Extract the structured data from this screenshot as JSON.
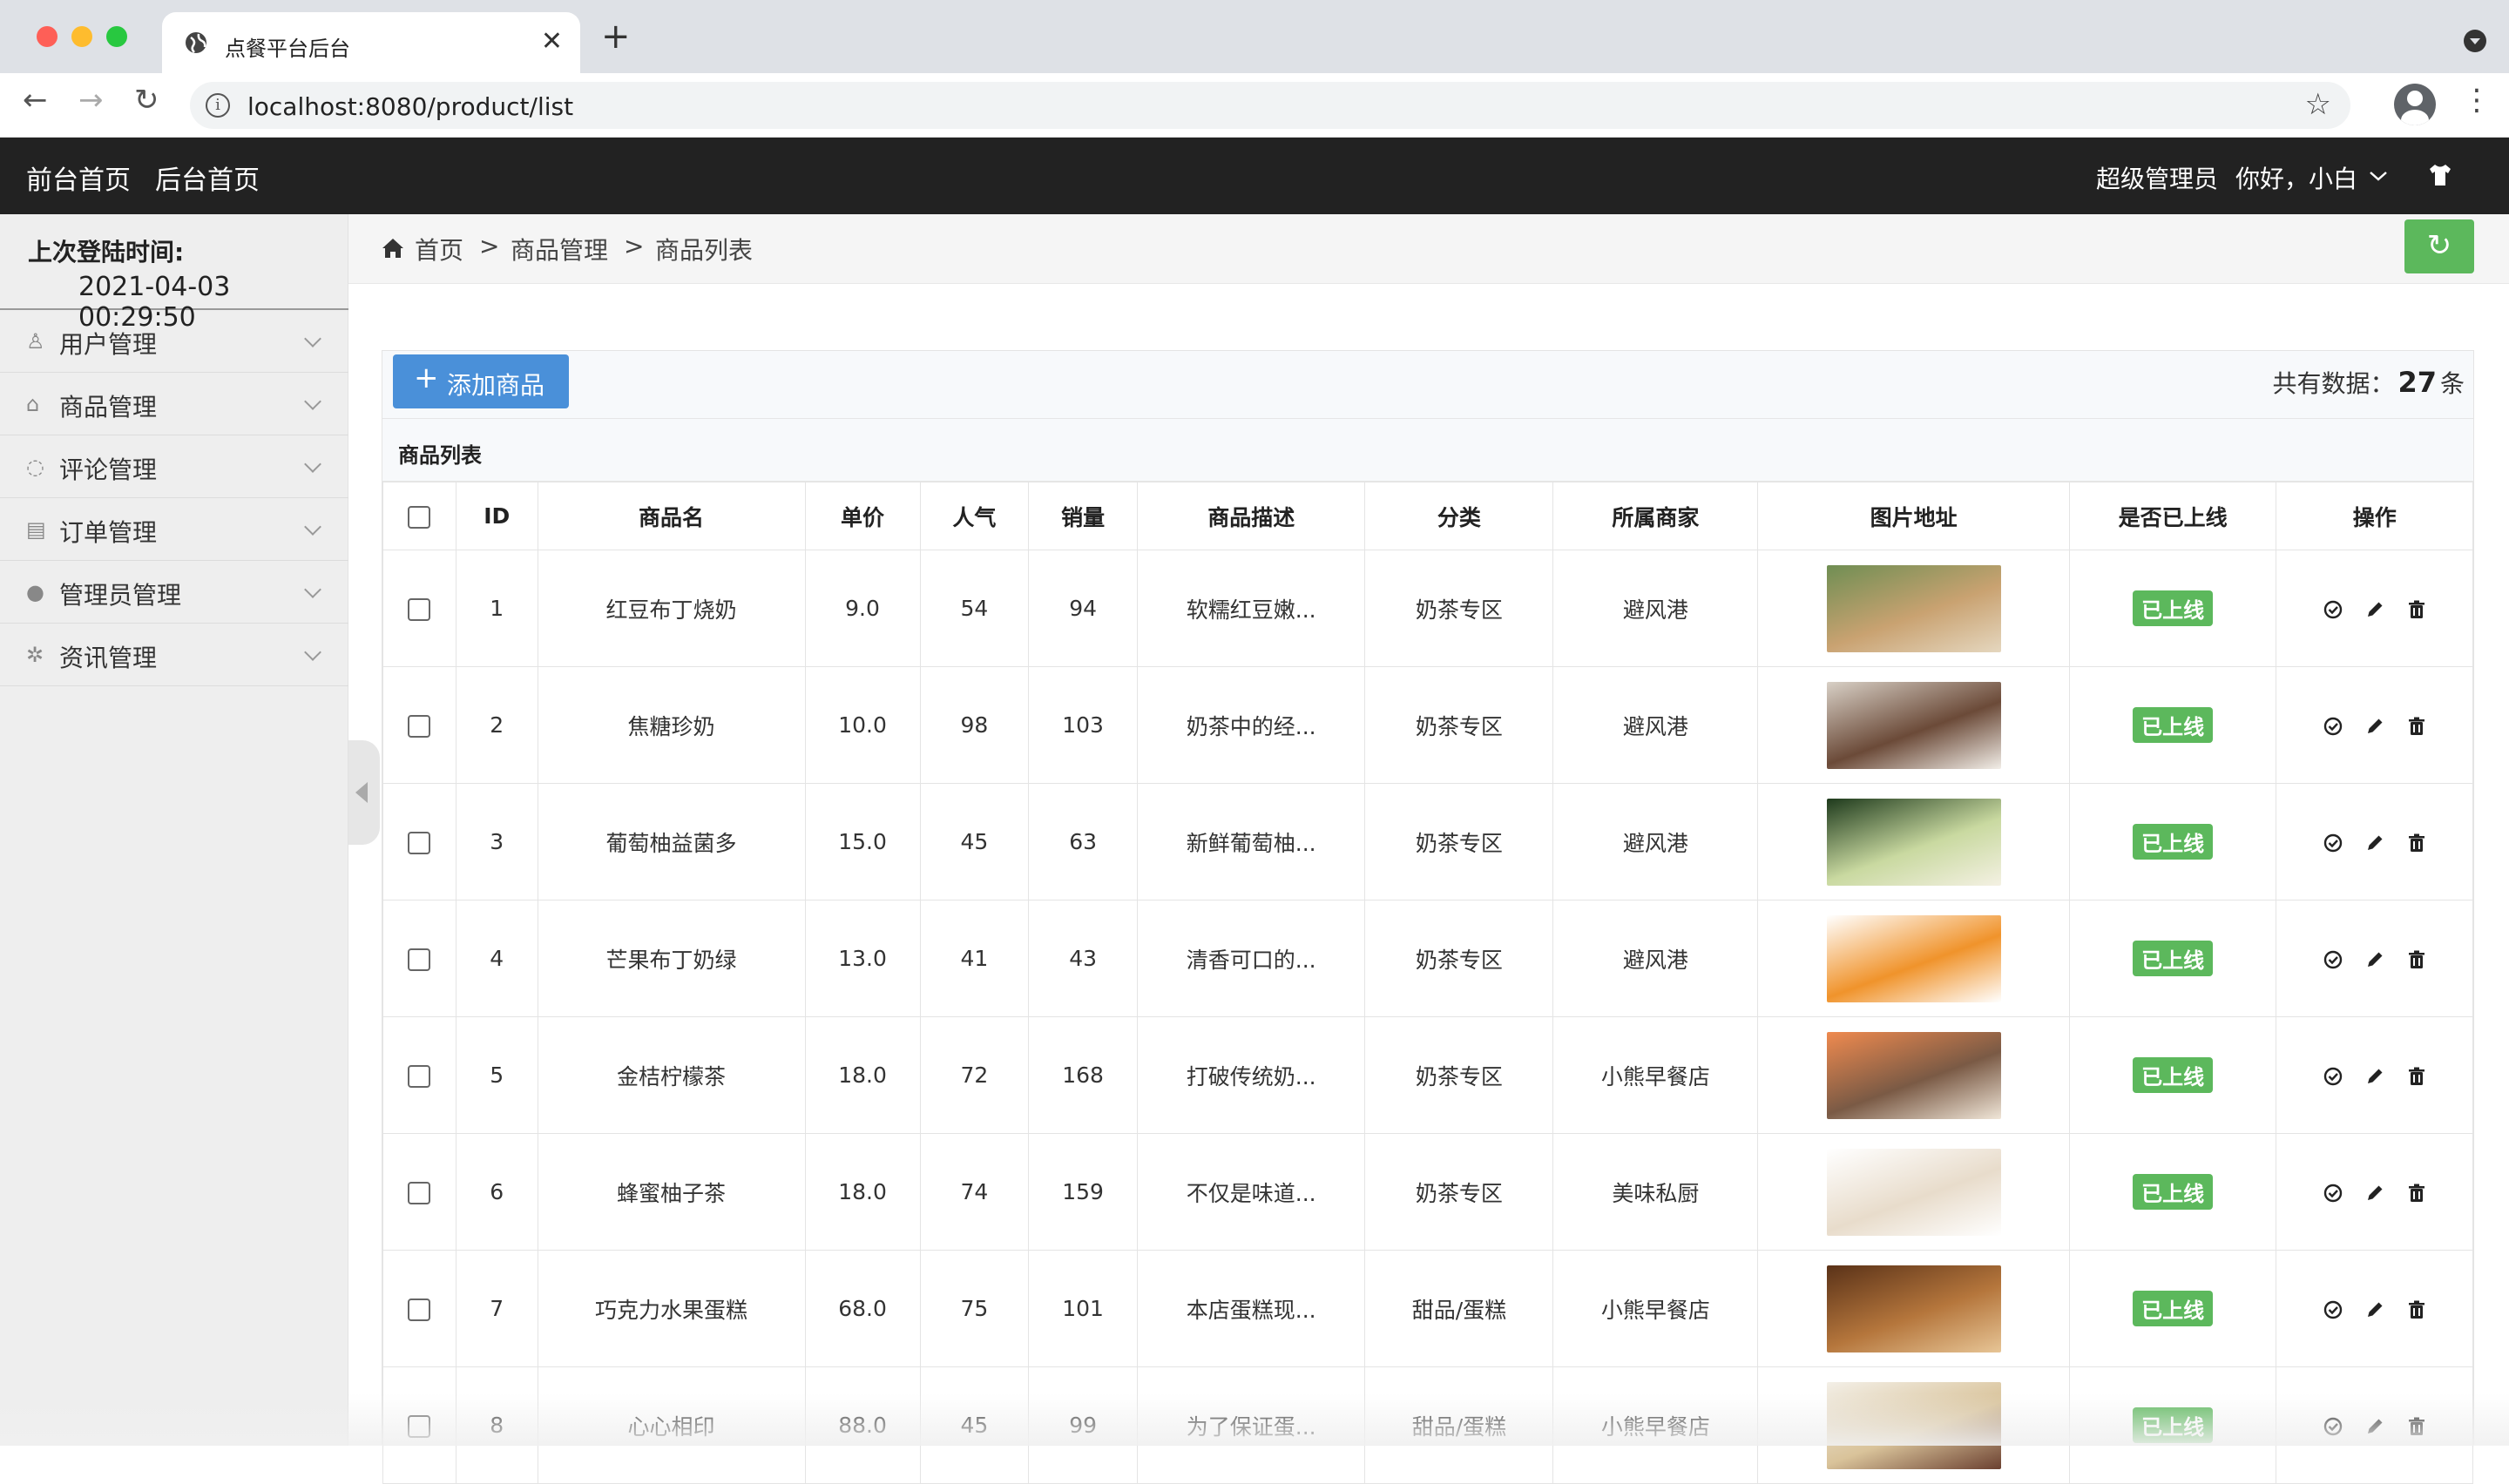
{
  "browser": {
    "tab_title": "点餐平台后台",
    "url": "localhost:8080/product/list",
    "close_glyph": "✕",
    "new_tab_glyph": "+",
    "back_glyph": "←",
    "forward_glyph": "→",
    "reload_glyph": "↻",
    "info_glyph": "i",
    "star_glyph": "☆",
    "menu_glyph": "⋮",
    "traffic_lights": [
      "#fe5f57",
      "#febc2e",
      "#28c840"
    ]
  },
  "header": {
    "front_home": "前台首页",
    "back_home": "后台首页",
    "role": "超级管理员",
    "greeting": "你好，小白",
    "bg_color": "#222222"
  },
  "sidebar": {
    "last_login_label": "上次登陆时间:",
    "last_login_time": "2021-04-03 00:29:50",
    "items": [
      {
        "label": "用户管理",
        "icon": "user-icon",
        "glyph": "♙"
      },
      {
        "label": "商品管理",
        "icon": "bag-icon",
        "glyph": "⌂"
      },
      {
        "label": "评论管理",
        "icon": "comment-icon",
        "glyph": "◌"
      },
      {
        "label": "订单管理",
        "icon": "image-icon",
        "glyph": "▤"
      },
      {
        "label": "管理员管理",
        "icon": "admin-icon",
        "glyph": "●"
      },
      {
        "label": "资讯管理",
        "icon": "gear-icon",
        "glyph": "✲"
      }
    ]
  },
  "breadcrumb": {
    "home": "首页",
    "sep": ">",
    "section": "商品管理",
    "page": "商品列表",
    "refresh_glyph": "↻"
  },
  "panel": {
    "add_label": "添加商品",
    "add_glyph": "+",
    "total_prefix": "共有数据：",
    "total_count": "27",
    "total_suffix": "条",
    "title": "商品列表"
  },
  "table": {
    "columns": [
      "",
      "ID",
      "商品名",
      "单价",
      "人气",
      "销量",
      "商品描述",
      "分类",
      "所属商家",
      "图片地址",
      "是否已上线",
      "操作"
    ],
    "status_color": "#5cb85c",
    "rows": [
      {
        "id": "1",
        "name": "红豆布丁烧奶",
        "price": "9.0",
        "popularity": "54",
        "sales": "94",
        "desc": "软糯红豆嫩...",
        "category": "奶茶专区",
        "merchant": "避风港",
        "status": "已上线",
        "img": [
          "#6f8e53",
          "#c9a271",
          "#e5d7bf"
        ]
      },
      {
        "id": "2",
        "name": "焦糖珍奶",
        "price": "10.0",
        "popularity": "98",
        "sales": "103",
        "desc": "奶茶中的经...",
        "category": "奶茶专区",
        "merchant": "避风港",
        "status": "已上线",
        "img": [
          "#d8d0c6",
          "#6b4a38",
          "#f2eee8"
        ]
      },
      {
        "id": "3",
        "name": "葡萄柚益菌多",
        "price": "15.0",
        "popularity": "45",
        "sales": "63",
        "desc": "新鲜葡萄柚...",
        "category": "奶茶专区",
        "merchant": "避风港",
        "status": "已上线",
        "img": [
          "#1e3a1c",
          "#c9d9a0",
          "#f4f1e3"
        ]
      },
      {
        "id": "4",
        "name": "芒果布丁奶绿",
        "price": "13.0",
        "popularity": "41",
        "sales": "43",
        "desc": "清香可口的...",
        "category": "奶茶专区",
        "merchant": "避风港",
        "status": "已上线",
        "img": [
          "#ffffff",
          "#f0932b",
          "#ffffff"
        ]
      },
      {
        "id": "5",
        "name": "金桔柠檬茶",
        "price": "18.0",
        "popularity": "72",
        "sales": "168",
        "desc": "打破传统奶...",
        "category": "奶茶专区",
        "merchant": "小熊早餐店",
        "status": "已上线",
        "img": [
          "#ef8a4f",
          "#7a5a45",
          "#f0e6d8"
        ]
      },
      {
        "id": "6",
        "name": "蜂蜜柚子茶",
        "price": "18.0",
        "popularity": "74",
        "sales": "159",
        "desc": "不仅是味道...",
        "category": "奶茶专区",
        "merchant": "美味私厨",
        "status": "已上线",
        "img": [
          "#ffffff",
          "#e8dccb",
          "#ffffff"
        ]
      },
      {
        "id": "7",
        "name": "巧克力水果蛋糕",
        "price": "68.0",
        "popularity": "75",
        "sales": "101",
        "desc": "本店蛋糕现...",
        "category": "甜品/蛋糕",
        "merchant": "小熊早餐店",
        "status": "已上线",
        "img": [
          "#5a3218",
          "#b5763c",
          "#e7c596"
        ]
      },
      {
        "id": "8",
        "name": "心心相印",
        "price": "88.0",
        "popularity": "45",
        "sales": "99",
        "desc": "为了保证蛋...",
        "category": "甜品/蛋糕",
        "merchant": "小熊早餐店",
        "status": "已上线",
        "img": [
          "#f3efe7",
          "#d9c39a",
          "#6b4030"
        ]
      }
    ]
  }
}
